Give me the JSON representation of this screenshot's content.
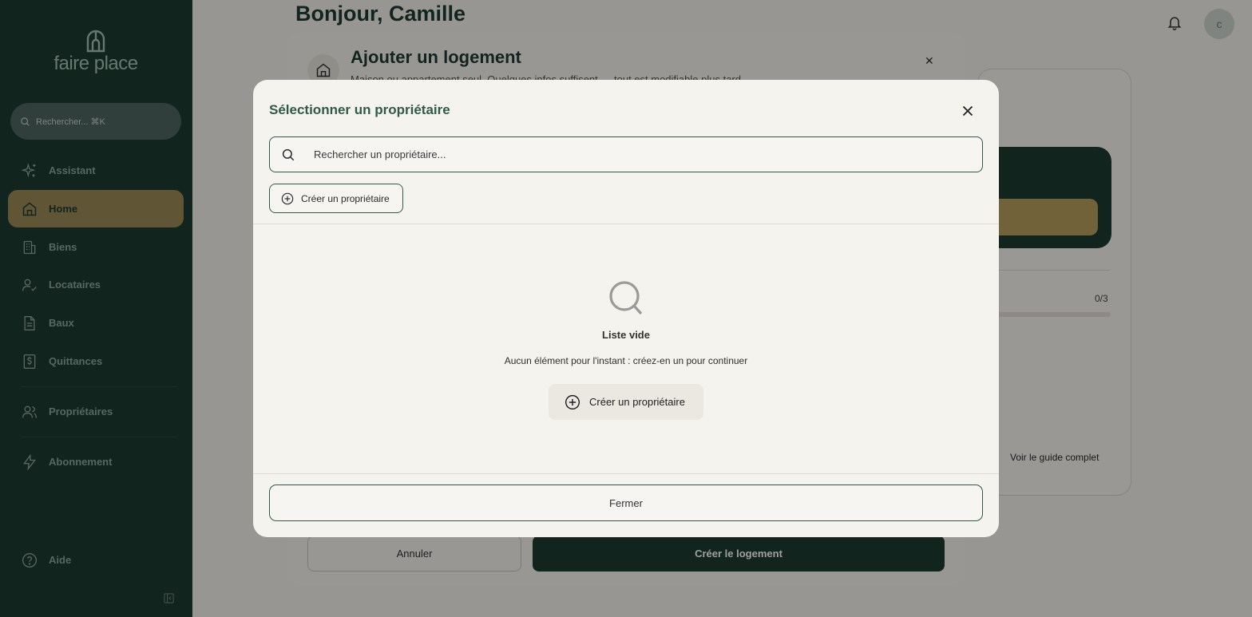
{
  "sidebar": {
    "logo_text": "faire place",
    "search_label": "Rechercher... ⌘K",
    "items": [
      {
        "label": "Assistant",
        "icon": "sparkles-icon"
      },
      {
        "label": "Home",
        "icon": "home-icon",
        "active": true
      },
      {
        "label": "Biens",
        "icon": "building-icon"
      },
      {
        "label": "Locataires",
        "icon": "user-check-icon"
      },
      {
        "label": "Baux",
        "icon": "document-icon"
      },
      {
        "label": "Quittances",
        "icon": "receipt-icon"
      },
      {
        "label": "Propriétaires",
        "icon": "users-icon"
      },
      {
        "label": "Abonnement",
        "icon": "bolt-icon"
      },
      {
        "label": "Aide",
        "icon": "help-icon"
      }
    ]
  },
  "header": {
    "greeting": "Bonjour, Camille",
    "avatar_initial": "c"
  },
  "guide": {
    "progress_count": "0/3",
    "link_label": "Voir le guide complet"
  },
  "add_home_modal": {
    "title": "Ajouter un logement",
    "subtitle": "Maison ou appartement seul. Quelques infos suffisent — tout est modifiable plus tard.",
    "cancel_label": "Annuler",
    "create_label": "Créer le logement"
  },
  "owner_modal": {
    "title": "Sélectionner un propriétaire",
    "search_placeholder": "Rechercher un propriétaire...",
    "create_small_label": "Créer un propriétaire",
    "empty_title": "Liste vide",
    "empty_desc": "Aucun élément pour l'instant : créez-en un pour continuer",
    "create_big_label": "Créer un propriétaire",
    "close_label": "Fermer"
  },
  "colors": {
    "sidebar_bg": "#1d3a31",
    "active_nav": "#9c8b57",
    "accent_green": "#2f5a48",
    "modal_bg": "#f5f3ee"
  }
}
